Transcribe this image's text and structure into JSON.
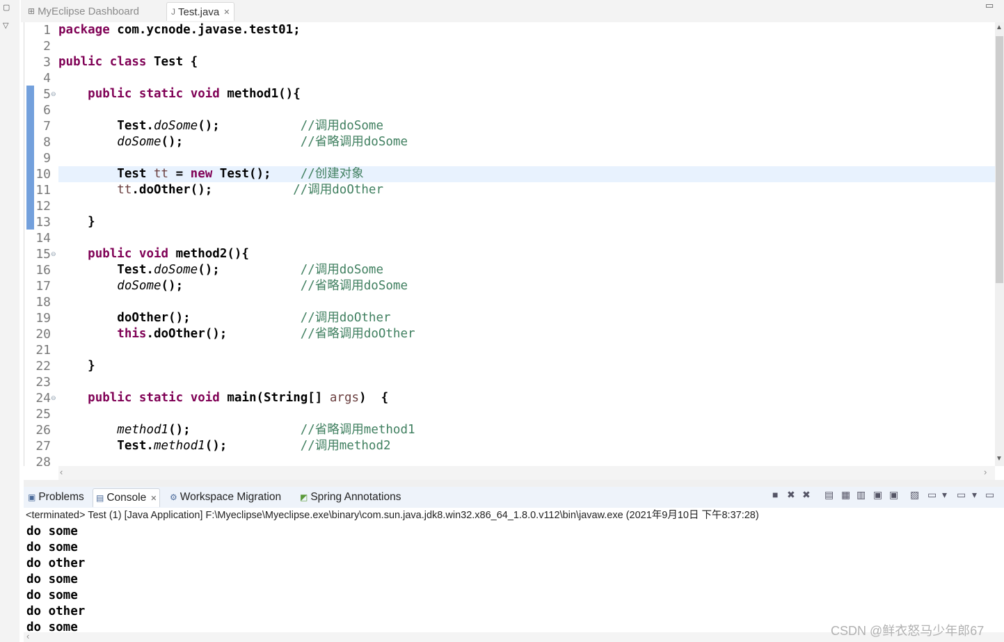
{
  "editor_tabs": [
    {
      "label": "MyEclipse Dashboard",
      "icon": "dashboard-icon"
    },
    {
      "label": "Test.java",
      "icon": "java-file-icon",
      "close": "✕"
    }
  ],
  "code_lines": [
    {
      "n": "1",
      "tokens": [
        {
          "t": "package",
          "c": "kw"
        },
        {
          "t": " com.ycnode.javase.test01;"
        }
      ]
    },
    {
      "n": "2",
      "tokens": []
    },
    {
      "n": "3",
      "tokens": [
        {
          "t": "public",
          "c": "kw"
        },
        {
          "t": " "
        },
        {
          "t": "class",
          "c": "kw"
        },
        {
          "t": " Test {"
        }
      ]
    },
    {
      "n": "4",
      "tokens": []
    },
    {
      "n": "5",
      "fold": true,
      "tokens": [
        {
          "t": "    "
        },
        {
          "t": "public",
          "c": "kw"
        },
        {
          "t": " "
        },
        {
          "t": "static",
          "c": "kw"
        },
        {
          "t": " "
        },
        {
          "t": "void",
          "c": "kw"
        },
        {
          "t": " method1(){"
        }
      ]
    },
    {
      "n": "6",
      "tokens": []
    },
    {
      "n": "7",
      "tokens": [
        {
          "t": "        Test."
        },
        {
          "t": "doSome",
          "c": "it"
        },
        {
          "t": "();           "
        },
        {
          "t": "//调用doSome",
          "c": "cm"
        }
      ]
    },
    {
      "n": "8",
      "tokens": [
        {
          "t": "        "
        },
        {
          "t": "doSome",
          "c": "it"
        },
        {
          "t": "();                "
        },
        {
          "t": "//省略调用doSome",
          "c": "cm"
        }
      ]
    },
    {
      "n": "9",
      "tokens": []
    },
    {
      "n": "10",
      "current": true,
      "tokens": [
        {
          "t": "        Test "
        },
        {
          "t": "tt",
          "c": "fld"
        },
        {
          "t": " = "
        },
        {
          "t": "new",
          "c": "kw"
        },
        {
          "t": " Test();    "
        },
        {
          "t": "//创建对象",
          "c": "cm"
        }
      ]
    },
    {
      "n": "11",
      "tokens": [
        {
          "t": "        "
        },
        {
          "t": "tt",
          "c": "fld"
        },
        {
          "t": ".doOther();           "
        },
        {
          "t": "//调用doOther",
          "c": "cm"
        }
      ]
    },
    {
      "n": "12",
      "tokens": []
    },
    {
      "n": "13",
      "tokens": [
        {
          "t": "    }"
        }
      ]
    },
    {
      "n": "14",
      "tokens": []
    },
    {
      "n": "15",
      "fold": true,
      "tokens": [
        {
          "t": "    "
        },
        {
          "t": "public",
          "c": "kw"
        },
        {
          "t": " "
        },
        {
          "t": "void",
          "c": "kw"
        },
        {
          "t": " method2(){"
        }
      ]
    },
    {
      "n": "16",
      "tokens": [
        {
          "t": "        Test."
        },
        {
          "t": "doSome",
          "c": "it"
        },
        {
          "t": "();           "
        },
        {
          "t": "//调用doSome",
          "c": "cm"
        }
      ]
    },
    {
      "n": "17",
      "tokens": [
        {
          "t": "        "
        },
        {
          "t": "doSome",
          "c": "it"
        },
        {
          "t": "();                "
        },
        {
          "t": "//省略调用doSome",
          "c": "cm"
        }
      ]
    },
    {
      "n": "18",
      "tokens": []
    },
    {
      "n": "19",
      "tokens": [
        {
          "t": "        doOther();               "
        },
        {
          "t": "//调用doOther",
          "c": "cm"
        }
      ]
    },
    {
      "n": "20",
      "tokens": [
        {
          "t": "        "
        },
        {
          "t": "this",
          "c": "kw"
        },
        {
          "t": ".doOther();          "
        },
        {
          "t": "//省略调用doOther",
          "c": "cm"
        }
      ]
    },
    {
      "n": "21",
      "tokens": []
    },
    {
      "n": "22",
      "tokens": [
        {
          "t": "    }"
        }
      ]
    },
    {
      "n": "23",
      "tokens": []
    },
    {
      "n": "24",
      "fold": true,
      "tokens": [
        {
          "t": "    "
        },
        {
          "t": "public",
          "c": "kw"
        },
        {
          "t": " "
        },
        {
          "t": "static",
          "c": "kw"
        },
        {
          "t": " "
        },
        {
          "t": "void",
          "c": "kw"
        },
        {
          "t": " main(String[] "
        },
        {
          "t": "args",
          "c": "fld"
        },
        {
          "t": ")  {"
        }
      ]
    },
    {
      "n": "25",
      "tokens": []
    },
    {
      "n": "26",
      "tokens": [
        {
          "t": "        "
        },
        {
          "t": "method1",
          "c": "it"
        },
        {
          "t": "();               "
        },
        {
          "t": "//省略调用method1",
          "c": "cm"
        }
      ]
    },
    {
      "n": "27",
      "tokens": [
        {
          "t": "        Test."
        },
        {
          "t": "method1",
          "c": "it"
        },
        {
          "t": "();          "
        },
        {
          "t": "//调用method2",
          "c": "cm"
        }
      ]
    },
    {
      "n": "28",
      "tokens": []
    }
  ],
  "panel_tabs": [
    {
      "label": "Problems",
      "icon": "problems-icon"
    },
    {
      "label": "Console",
      "icon": "console-icon",
      "active": true,
      "close": "✕"
    },
    {
      "label": "Workspace Migration",
      "icon": "migration-icon"
    },
    {
      "label": "Spring Annotations",
      "icon": "spring-icon"
    }
  ],
  "console": {
    "header": "<terminated> Test (1) [Java Application] F:\\Myeclipse\\Myeclipse.exe\\binary\\com.sun.java.jdk8.win32.x86_64_1.8.0.v112\\bin\\javaw.exe (2021年9月10日 下午8:37:28)",
    "lines": [
      "do some",
      "do some",
      "do other",
      "do some",
      "do some",
      "do other",
      "do some"
    ]
  },
  "watermark": "CSDN @鲜衣怒马少年郎67",
  "colors": {
    "keyword": "#7f0055",
    "comment": "#3f7f5f",
    "field": "#6a3e3e",
    "current_line": "#e8f2fe"
  }
}
